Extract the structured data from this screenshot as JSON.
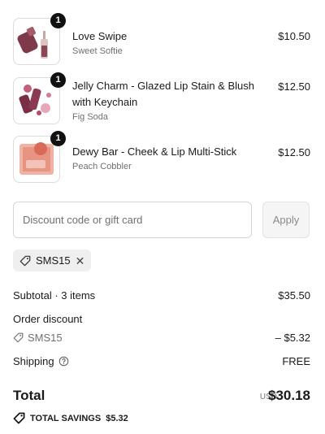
{
  "line_items": [
    {
      "quantity": "1",
      "title": "Love Swipe",
      "variant": "Sweet Softie",
      "price": "$10.50"
    },
    {
      "quantity": "1",
      "title": "Jelly Charm - Glazed Lip Stain & Blush with Keychain",
      "variant": "Fig Soda",
      "price": "$12.50"
    },
    {
      "quantity": "1",
      "title": "Dewy Bar - Cheek & Lip Multi-Stick",
      "variant": "Peach Cobbler",
      "price": "$12.50"
    }
  ],
  "discount": {
    "placeholder": "Discount code or gift card",
    "value": "",
    "apply_label": "Apply",
    "applied_code": "SMS15"
  },
  "summary": {
    "subtotal_label": "Subtotal · 3 items",
    "subtotal_value": "$35.50",
    "order_discount_label": "Order discount",
    "discount_code": "SMS15",
    "discount_value": "– $5.32",
    "shipping_label": "Shipping",
    "shipping_value": "FREE",
    "total_label": "Total",
    "currency": "USD",
    "total_value": "$30.18",
    "savings_label": "TOTAL SAVINGS",
    "savings_value": "$5.32"
  },
  "icons": {
    "tag": "tag-icon",
    "close": "close-icon",
    "help": "help-circle-icon"
  },
  "colors": {
    "badge": "#111111",
    "apply_button_bg": "#f5f5f5",
    "code_tag_bg": "#efefef",
    "muted_text": "#707070"
  }
}
